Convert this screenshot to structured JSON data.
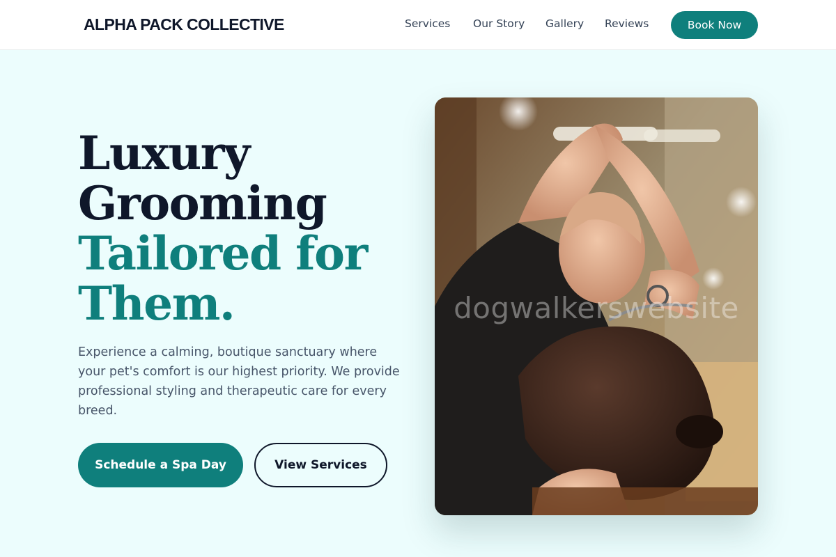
{
  "brand": {
    "name": "ALPHA PACK COLLECTIVE"
  },
  "nav": {
    "links": [
      "Services",
      "Our Story",
      "Gallery",
      "Reviews"
    ],
    "cta_label": "Book Now"
  },
  "hero": {
    "title_lines": [
      "Luxury",
      "Grooming",
      "Tailored for",
      "Them."
    ],
    "description": "Experience a calming, boutique sanctuary where your pet's comfort is our highest priority. We provide professional styling and therapeutic care for every breed.",
    "primary_button": "Schedule a Spa Day",
    "secondary_button": "View Services",
    "image_watermark": "dogwalkerswebsite"
  },
  "colors": {
    "accent": "#0f7f7c",
    "heading": "#0f172a",
    "background": "#ecfdfd",
    "body_text": "#475569"
  }
}
